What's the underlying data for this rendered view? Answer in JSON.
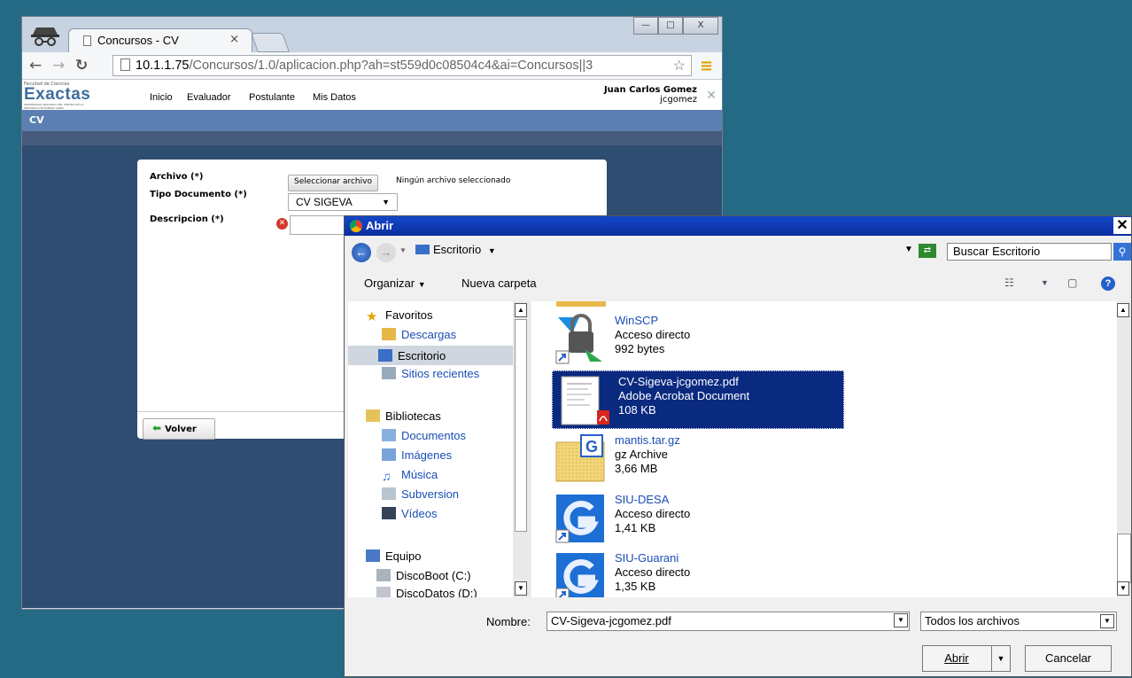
{
  "browser": {
    "tab_title": "Concursos - CV",
    "tab_close": "×",
    "url_host": "10.1.1.75",
    "url_path": "/Concursos/1.0/aplicacion.php?ah=st559d0c08504c4&ai=Concursos||3",
    "window_buttons": [
      "—",
      "□",
      "X"
    ]
  },
  "site": {
    "logo_top": "Facultad de Ciencias",
    "logo_text": "Exactas",
    "logo_sub": "UNIVERSIDAD NACIONAL DEL CENTRO DE LA PROVINCIA DE BUENOS AIRES",
    "nav": [
      "Inicio",
      "Evaluador",
      "Postulante",
      "Mis Datos"
    ],
    "user_name": "Juan Carlos Gomez",
    "user_login": "jcgomez",
    "section": "CV"
  },
  "form": {
    "archivo_label": "Archivo (*)",
    "file_button": "Seleccionar archivo",
    "file_status": "Ningún archivo seleccionado",
    "tipo_label": "Tipo Documento (*)",
    "tipo_value": "CV SIGEVA",
    "descripcion_label": "Descripcion (*)",
    "volver_label": "Volver"
  },
  "dialog": {
    "title": "Abrir",
    "location": "Escritorio",
    "search_placeholder": "Buscar Escritorio",
    "organize": "Organizar",
    "new_folder": "Nueva carpeta",
    "nav": {
      "favorites": "Favoritos",
      "fav_items": [
        "Descargas",
        "Escritorio",
        "Sitios recientes"
      ],
      "libraries": "Bibliotecas",
      "lib_items": [
        "Documentos",
        "Imágenes",
        "Música",
        "Subversion",
        "Vídeos"
      ],
      "computer": "Equipo",
      "drives": [
        "DiscoBoot (C:)",
        "DiscoDatos (D:)"
      ]
    },
    "files": [
      {
        "name": "WinSCP",
        "type": "Acceso directo",
        "size": "992 bytes",
        "icon": "winscp-icon"
      },
      {
        "name": "CV-Sigeva-jcgomez.pdf",
        "type": "Adobe Acrobat Document",
        "size": "108 KB",
        "icon": "pdf-icon"
      },
      {
        "name": "mantis.tar.gz",
        "type": "gz Archive",
        "size": "3,66 MB",
        "icon": "archive-icon"
      },
      {
        "name": "SIU-DESA",
        "type": "Acceso directo",
        "size": "1,41 KB",
        "icon": "siu-icon"
      },
      {
        "name": "SIU-Guarani",
        "type": "Acceso directo",
        "size": "1,35 KB",
        "icon": "siu-icon"
      }
    ],
    "filename_label": "Nombre:",
    "filename_value": "CV-Sigeva-jcgomez.pdf",
    "filter": "Todos los archivos",
    "open_button": "Abrir",
    "cancel_button": "Cancelar"
  }
}
